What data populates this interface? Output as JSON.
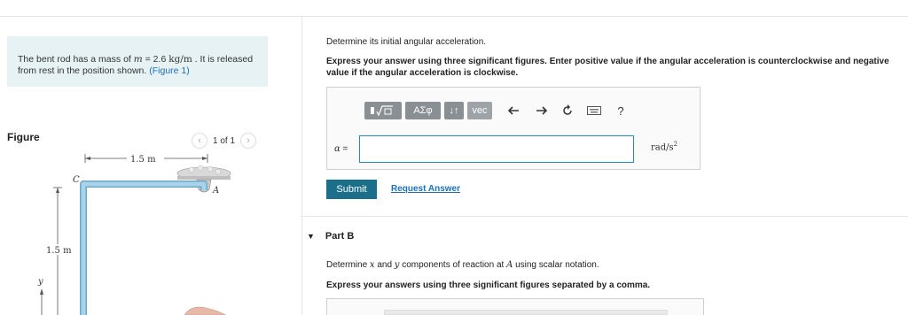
{
  "problem": {
    "text_prefix": "The bent rod has a mass of ",
    "var_m": "m",
    "equals": " = 2.6 ",
    "unit": "kg/m",
    "text_mid": " . It is released from rest in the position shown. ",
    "figure_link": "(Figure 1)"
  },
  "figure": {
    "label": "Figure",
    "pager_text": "1 of 1",
    "prev_icon": "chevron-left-icon",
    "next_icon": "chevron-right-icon",
    "dim_top": "1.5 m",
    "dim_left": "1.5 m",
    "point_c": "C",
    "point_a": "A",
    "axis_y": "y"
  },
  "part_a": {
    "prompt": "Determine its initial angular acceleration.",
    "instruction": "Express your answer using three significant figures. Enter positive value if the angular acceleration is counterclockwise and negative value if the angular acceleration is clockwise.",
    "toolbar": {
      "templates_icon": "templates-icon",
      "greek_label": "ΑΣφ",
      "arrows_label": "↓↑",
      "vec_label": "vec",
      "undo_icon": "undo-icon",
      "redo_icon": "redo-icon",
      "reset_icon": "reset-icon",
      "keyboard_icon": "keyboard-icon",
      "help_label": "?"
    },
    "answer_var": "α",
    "answer_eq": " =",
    "answer_value": "",
    "unit_base": "rad/s",
    "unit_exp": "2",
    "submit_label": "Submit",
    "request_label": "Request Answer"
  },
  "part_b": {
    "title": "Part B",
    "prompt_prefix": "Determine ",
    "var_x": "x",
    "prompt_and": " and ",
    "var_y": "y",
    "prompt_mid": " components of reaction at ",
    "var_a": "A",
    "prompt_suffix": " using scalar notation.",
    "instruction": "Express your answers using three significant figures separated by a comma."
  },
  "colors": {
    "problem_bg": "#e6f2f4",
    "accent_link": "#1f6fb2",
    "submit_bg": "#1c6f8b",
    "input_border": "#1f8fbf",
    "rod_fill": "#a9d3e8"
  }
}
